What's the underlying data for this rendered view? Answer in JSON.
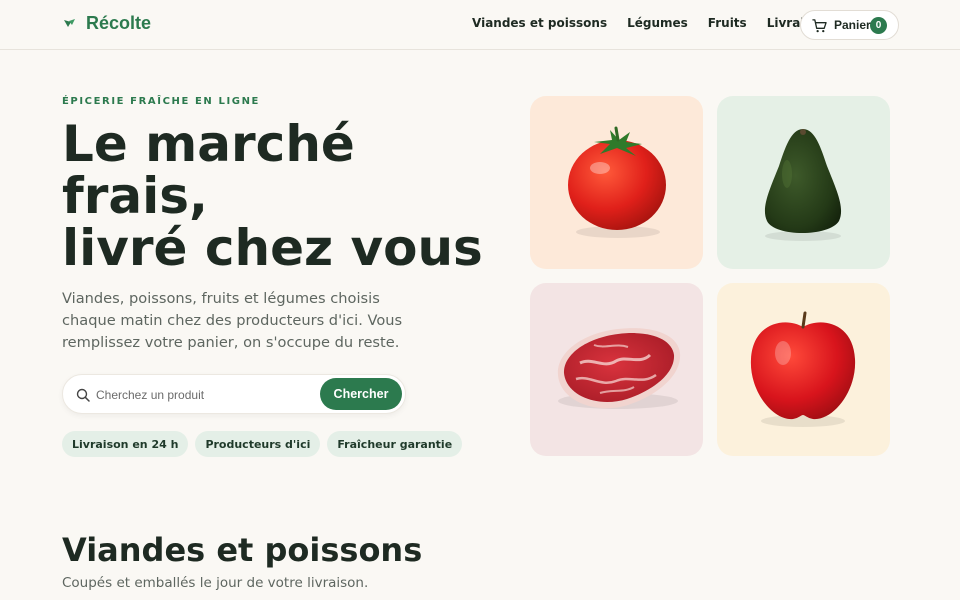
{
  "header": {
    "logo": "Récolte",
    "nav": [
      "Viandes et poissons",
      "Légumes",
      "Fruits",
      "Livraison"
    ],
    "cart_label": "Panier",
    "cart_count": "0"
  },
  "hero": {
    "eyebrow": "ÉPICERIE FRAÎCHE EN LIGNE",
    "title_lines": [
      "Le marché",
      "frais,",
      "livré chez vous"
    ],
    "description": "Viandes, poissons, fruits et légumes choisis chaque matin chez des producteurs d'ici. Vous remplissez votre panier, on s'occupe du reste.",
    "search_placeholder": "Cherchez un produit",
    "search_button": "Chercher",
    "badges": [
      "Livraison en 24 h",
      "Producteurs d'ici",
      "Fraîcheur garantie"
    ]
  },
  "section": {
    "title": "Viandes et poissons",
    "subtitle": "Coupés et emballés le jour de votre livraison."
  },
  "colors": {
    "accent": "#2c7a4e",
    "text": "#1e2a22",
    "background": "#faf8f4"
  },
  "icons": [
    "leaf-icon",
    "cart-icon",
    "search-icon"
  ],
  "tiles": [
    "tomato-image",
    "avocado-image",
    "steak-image",
    "apple-image"
  ]
}
